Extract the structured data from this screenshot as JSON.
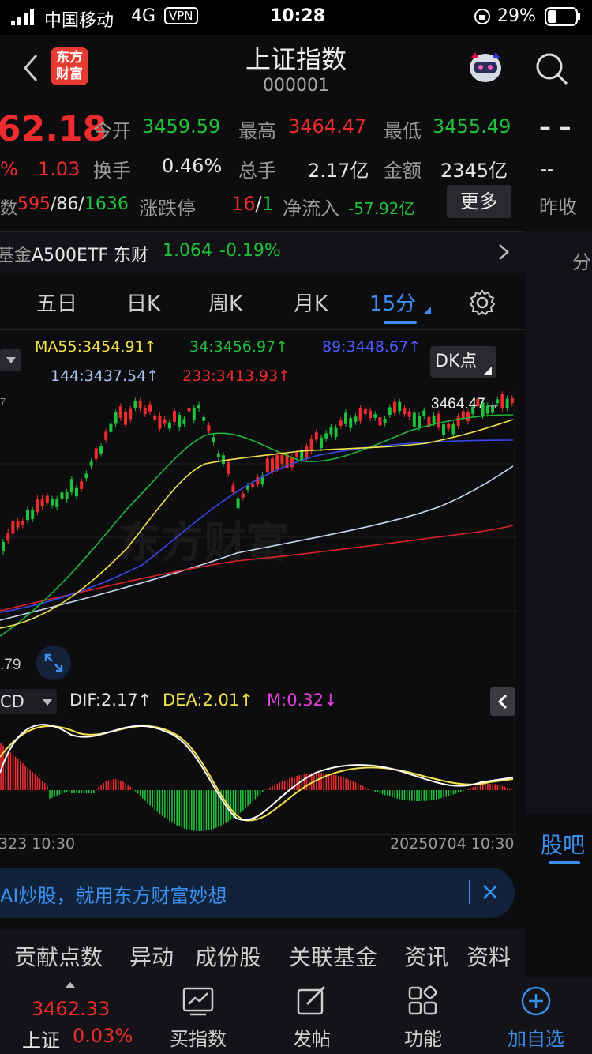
{
  "status_bar": {
    "carrier": "中国移动",
    "network": "4G",
    "vpn": "VPN",
    "time": "10:28",
    "battery": "29%"
  },
  "header": {
    "title": "上证指数",
    "code": "000001",
    "logo_line1": "东方",
    "logo_line2": "财富"
  },
  "quote": {
    "price": "62.18",
    "pct_fragment": "%",
    "change": "1.03",
    "open_label": "今开",
    "open": "3459.59",
    "high_label": "最高",
    "high": "3464.47",
    "low_label": "最低",
    "low": "3455.49",
    "turnover_label": "换手",
    "turnover": "0.46%",
    "volume_label": "总手",
    "volume": "2.17亿",
    "amount_label": "金额",
    "amount": "2345亿",
    "breadth_prefix": "数",
    "up_count": "595",
    "flat_count": "86",
    "down_count": "1636",
    "limit_label": "涨跌停",
    "limit_up": "16",
    "limit_down": "1",
    "netflow_label": "净流入",
    "netflow": "-57.92亿",
    "more_button": "更多"
  },
  "right_col": {
    "dash1": "– –",
    "dash2": "--",
    "prev_close_label": "昨收",
    "fen": "分",
    "guba": "股吧"
  },
  "fund": {
    "prefix": "基金",
    "name": "A500ETF 东财",
    "price": "1.064",
    "change": "-0.19%"
  },
  "tabs": [
    "五日",
    "日K",
    "周K",
    "月K",
    "15分"
  ],
  "active_tab": "15分",
  "ma": {
    "ma55": "MA55:3454.91↑",
    "ma34": "34:3456.97↑",
    "ma89": "89:3448.67↑",
    "ma144": "144:3437.54↑",
    "ma233": "233:3413.93↑",
    "dk_button": "DK点"
  },
  "chart": {
    "high_marker": "3464.47→",
    "low_value": ".79",
    "left_tick": "7",
    "watermark": "东方财富"
  },
  "macd": {
    "selector": "CD",
    "dif": "DIF:2.17↑",
    "dea": "DEA:2.01↑",
    "m": "M:0.32↓"
  },
  "time_axis": {
    "start": "323 10:30",
    "end": "20250704 10:30"
  },
  "banner": {
    "text": "AI炒股，就用东方财富妙想"
  },
  "sub_tabs": [
    "贡献点数",
    "异动",
    "成份股",
    "关联基金",
    "资讯",
    "资料"
  ],
  "bottom_nav": {
    "index_price": "3462.33",
    "index_name": "上证",
    "index_change": "0.03%",
    "items": [
      "买指数",
      "发帖",
      "功能",
      "加自选"
    ]
  },
  "colors": {
    "up": "#ef2b2d",
    "down": "#1fc23a",
    "accent": "#3b8ff0",
    "bg": "#0d0d0f"
  }
}
